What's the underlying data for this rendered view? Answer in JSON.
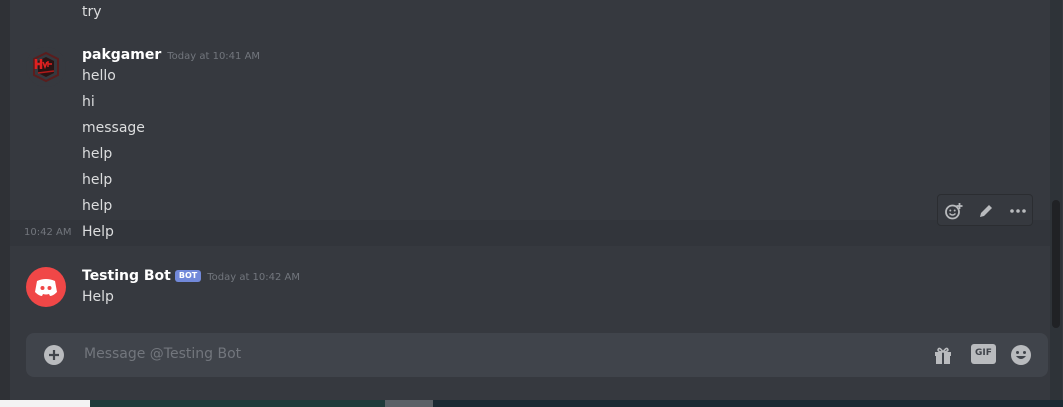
{
  "messages_top": {
    "prev_line": "try"
  },
  "group1": {
    "username": "pakgamer",
    "timestamp": "Today at 10:41 AM",
    "lines": [
      "hello",
      "hi",
      "message",
      "help",
      "help",
      "help"
    ],
    "last_line_time": "10:42 AM",
    "last_line": "Help"
  },
  "group2": {
    "username": "Testing Bot",
    "badge": "BOT",
    "timestamp": "Today at 10:42 AM",
    "text": "Help"
  },
  "toolbar": {
    "icons": [
      "add-reaction-icon",
      "edit-icon",
      "more-icon"
    ]
  },
  "composer": {
    "placeholder": "Message @Testing Bot",
    "gif_label": "GIF"
  },
  "colors": {
    "background": "#36393f",
    "composer": "#40444b",
    "bot_badge": "#7289da",
    "discord_avatar": "#f04747"
  }
}
